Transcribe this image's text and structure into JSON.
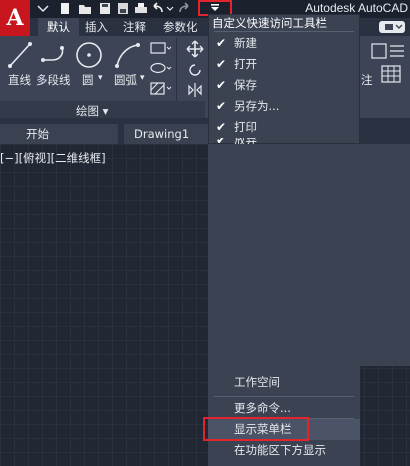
{
  "title_bar": {
    "logo_letter": "A",
    "app_title": "Autodesk AutoCAD"
  },
  "ribbon_tabs": [
    "默认",
    "插入",
    "注释",
    "参数化"
  ],
  "ribbon": {
    "tools": [
      "直线",
      "多段线",
      "圆",
      "圆弧"
    ],
    "group_label": "绘图 ▾",
    "right_partial_label": "注"
  },
  "doc_tabs": [
    "开始",
    "Drawing1"
  ],
  "viewport_label": "[−][俯视][二维线框]",
  "qat_menu": {
    "header": "自定义快速访问工具栏",
    "checked_items": [
      "新建",
      "打开",
      "保存",
      "另存为...",
      "打印",
      "放弃"
    ],
    "bottom_items": [
      "工作空间",
      "更多命令...",
      "显示菜单栏",
      "在功能区下方显示"
    ],
    "highlighted_item": "显示菜单栏"
  },
  "colors": {
    "accent_red": "#e0262c",
    "logo_red": "#c8161f",
    "menu_bg": "#3b4353",
    "ribbon_bg": "#3c4455",
    "canvas_bg": "#212733"
  }
}
